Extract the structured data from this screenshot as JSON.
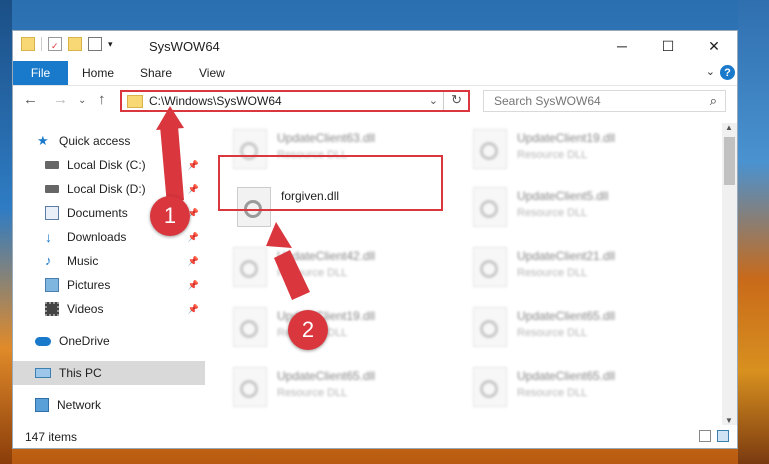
{
  "window": {
    "title": "SysWOW64",
    "controls": {
      "minimize": "─",
      "maximize": "☐",
      "close": "✕"
    }
  },
  "ribbon": {
    "file": "File",
    "tabs": [
      "Home",
      "Share",
      "View"
    ],
    "help": "?",
    "expand": "⌄"
  },
  "nav": {
    "back": "←",
    "forward": "→",
    "recent": "⌄",
    "up": "↑",
    "address": "C:\\Windows\\SysWOW64",
    "search_placeholder": "Search SysWOW64"
  },
  "sidebar": {
    "items": [
      {
        "label": "Quick access",
        "icon": "star-icon"
      },
      {
        "label": "Local Disk (C:)",
        "icon": "drive-icon",
        "pinned": true
      },
      {
        "label": "Local Disk (D:)",
        "icon": "drive-icon",
        "pinned": true
      },
      {
        "label": "Documents",
        "icon": "documents-icon",
        "pinned": true
      },
      {
        "label": "Downloads",
        "icon": "download-icon",
        "pinned": true
      },
      {
        "label": "Music",
        "icon": "music-icon",
        "pinned": true
      },
      {
        "label": "Pictures",
        "icon": "pictures-icon",
        "pinned": true
      },
      {
        "label": "Videos",
        "icon": "videos-icon",
        "pinned": true
      },
      {
        "label": "OneDrive",
        "icon": "cloud-icon"
      },
      {
        "label": "This PC",
        "icon": "computer-icon",
        "selected": true
      },
      {
        "label": "Network",
        "icon": "network-icon"
      }
    ]
  },
  "files": [
    {
      "name": "UpdateClient63.dll",
      "type": "Resource DLL"
    },
    {
      "name": "UpdateClient19.dll",
      "type": "Resource DLL"
    },
    {
      "name": "forgiven.dll",
      "type": ""
    },
    {
      "name": "UpdateClient5.dll",
      "type": "Resource DLL"
    },
    {
      "name": "UpdateClient42.dll",
      "type": "Resource DLL"
    },
    {
      "name": "UpdateClient21.dll",
      "type": "Resource DLL"
    },
    {
      "name": "UpdateClient19.dll",
      "type": "Resource DLL"
    },
    {
      "name": "UpdateClient65.dll",
      "type": "Resource DLL"
    },
    {
      "name": "UpdateClient65.dll",
      "type": "Resource DLL"
    },
    {
      "name": "UpdateClient65.dll",
      "type": "Resource DLL"
    }
  ],
  "status": {
    "count": "147 items"
  },
  "callouts": [
    "1",
    "2"
  ],
  "colors": {
    "accent": "#1979ca",
    "highlight": "#d9363e"
  }
}
